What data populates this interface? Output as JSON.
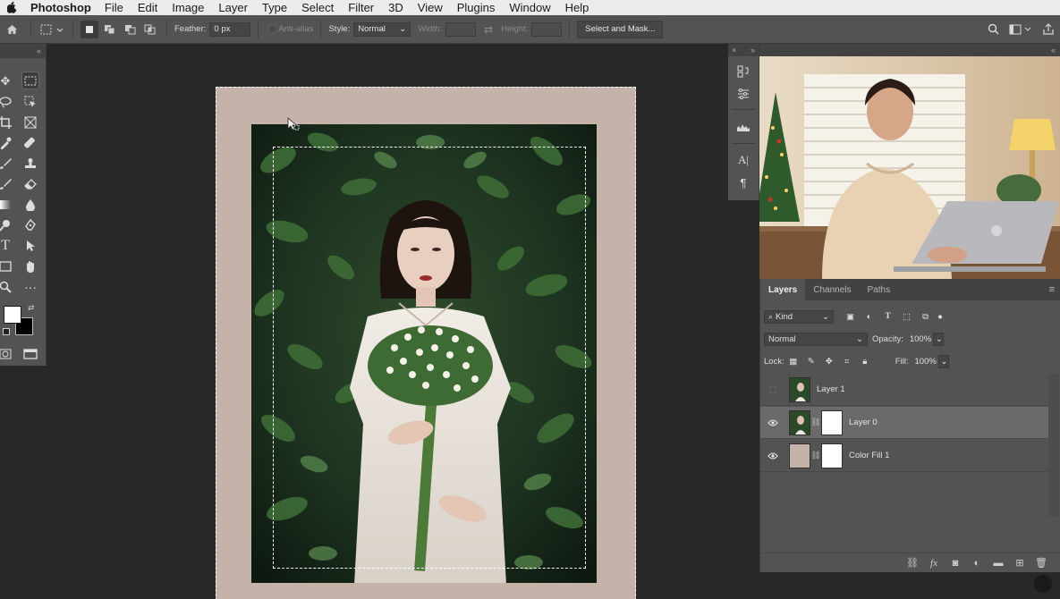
{
  "menubar": {
    "app_name": "Photoshop",
    "items": [
      "File",
      "Edit",
      "Image",
      "Layer",
      "Type",
      "Select",
      "Filter",
      "3D",
      "View",
      "Plugins",
      "Window",
      "Help"
    ]
  },
  "options_bar": {
    "feather_label": "Feather:",
    "feather_value": "0 px",
    "anti_alias_label": "Anti-alias",
    "style_label": "Style:",
    "style_value": "Normal",
    "width_label": "Width:",
    "height_label": "Height:",
    "select_mask_label": "Select and Mask..."
  },
  "layers_panel": {
    "tabs": [
      "Layers",
      "Channels",
      "Paths"
    ],
    "filter_kind": "Kind",
    "blend_mode": "Normal",
    "opacity_label": "Opacity:",
    "opacity_value": "100%",
    "lock_label": "Lock:",
    "fill_label": "Fill:",
    "fill_value": "100%",
    "layers": [
      {
        "name": "Layer 1",
        "visible": false,
        "selected": false
      },
      {
        "name": "Layer 0",
        "visible": true,
        "selected": true
      },
      {
        "name": "Color Fill 1",
        "visible": true,
        "selected": false
      }
    ]
  },
  "colors": {
    "ui_bg": "#535353",
    "canvas_bg": "#282828",
    "document_fill": "#c5b3aa",
    "selected_layer": "#6a6a6a"
  }
}
